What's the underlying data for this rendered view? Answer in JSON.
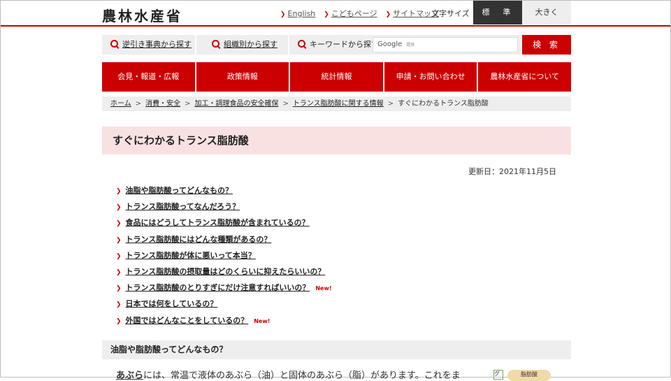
{
  "header": {
    "logo": "農林水産省",
    "links": [
      "English",
      "こどもページ",
      "サイトマップ"
    ],
    "font_size_label": "文字サイズ",
    "font_standard": "標　準",
    "font_large": "大きく"
  },
  "search": {
    "reverse_lookup": "逆引き事典から探す",
    "by_org": "組織別から探す",
    "keyword": "キーワードから探す",
    "input_brand": "Google",
    "input_suffix": "提供",
    "button": "検 索"
  },
  "nav": [
    "会見・報道・広報",
    "政策情報",
    "統計情報",
    "申請・お問い合わせ",
    "農林水産省について"
  ],
  "breadcrumb": {
    "links": [
      "ホーム",
      "消費・安全",
      "加工・調理食品の安全確保",
      "トランス脂肪酸に関する情報"
    ],
    "current": "すぐにわかるトランス脂肪酸",
    "sep": ">"
  },
  "page": {
    "title": "すぐにわかるトランス脂肪酸",
    "updated": "更新日：2021年11月5日"
  },
  "toc": [
    {
      "text": "油脂や脂肪酸ってどんなもの？",
      "new": ""
    },
    {
      "text": "トランス脂肪酸ってなんだろう？",
      "new": ""
    },
    {
      "text": "食品にはどうしてトランス脂肪酸が含まれているの？",
      "new": ""
    },
    {
      "text": "トランス脂肪酸にはどんな種類があるの？",
      "new": ""
    },
    {
      "text": "トランス脂肪酸が体に悪いって本当？",
      "new": ""
    },
    {
      "text": "トランス脂肪酸の摂取量はどのくらいに抑えたらいいの？",
      "new": ""
    },
    {
      "text": "トランス脂肪酸のとりすぎにだけ注意すればいいの？",
      "new": "New!"
    },
    {
      "text": "日本では何をしているの？",
      "new": ""
    },
    {
      "text": "外国ではどんなことをしているの？",
      "new": "New!"
    }
  ],
  "section": {
    "heading": "油脂や脂肪酸ってどんなもの？",
    "para_bold": "あぶら",
    "para_rest": "には、常温で液体のあぶら（油）と固体のあぶら（脂）があります。これをま",
    "side_g": "グ",
    "side_badge": "脂肪酸"
  },
  "colors": {
    "accent": "#cc0000",
    "title_bg": "#f9e1e1",
    "gray": "#eeeeee"
  }
}
